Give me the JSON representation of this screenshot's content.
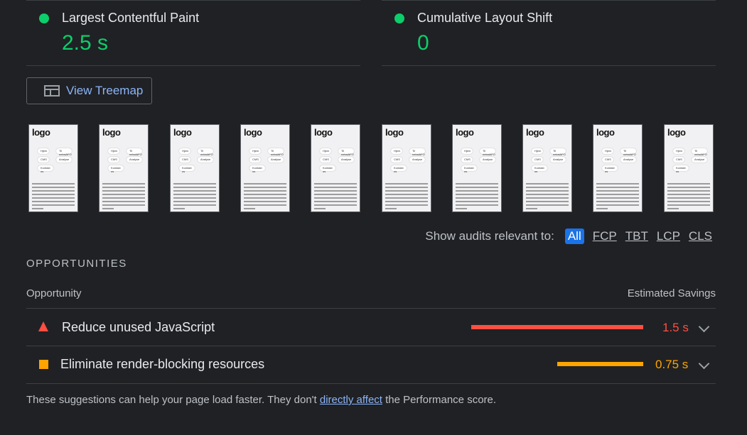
{
  "metrics": [
    {
      "label": "Largest Contentful Paint",
      "value": "2.5 s",
      "status_color": "#0cce6b"
    },
    {
      "label": "Cumulative Layout Shift",
      "value": "0",
      "status_color": "#0cce6b"
    }
  ],
  "treemap_button": {
    "label": "View Treemap",
    "icon": "treemap-icon"
  },
  "filmstrip": {
    "frame_count": 10,
    "frame": {
      "logo": "logo",
      "pills": [
        "Hjem",
        "Til nekstAFO",
        "CMS",
        "Analyse",
        "Kontakt os"
      ]
    }
  },
  "filter": {
    "label": "Show audits relevant to:",
    "options": [
      "All",
      "FCP",
      "TBT",
      "LCP",
      "CLS"
    ],
    "selected": "All"
  },
  "opportunities": {
    "section_title": "OPPORTUNITIES",
    "col_opportunity": "Opportunity",
    "col_savings": "Estimated Savings",
    "items": [
      {
        "title": "Reduce unused JavaScript",
        "savings": "1.5 s",
        "savings_value": 1.5,
        "severity": "fail",
        "color": "#ff4e42",
        "icon": "triangle-fail-icon"
      },
      {
        "title": "Eliminate render-blocking resources",
        "savings": "0.75 s",
        "savings_value": 0.75,
        "severity": "average",
        "color": "#ffa400",
        "icon": "square-average-icon"
      }
    ]
  },
  "footer": {
    "before": "These suggestions can help your page load faster. They don't ",
    "link": "directly affect",
    "after": " the Performance score."
  }
}
